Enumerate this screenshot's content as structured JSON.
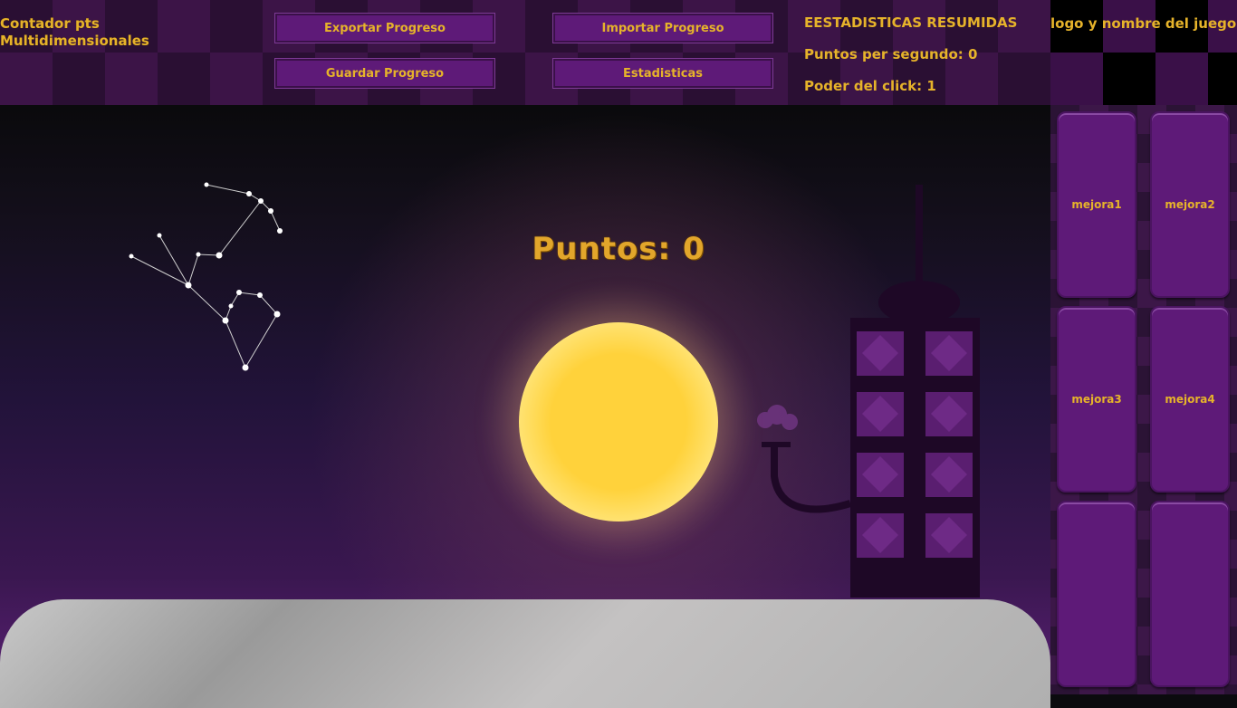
{
  "header": {
    "title": "Contador pts Multidimensionales",
    "export_label": "Exportar Progreso",
    "import_label": "Importar Progreso",
    "save_label": "Guardar Progreso",
    "stats_label": "Estadisticas"
  },
  "summary": {
    "heading": "EESTADISTICAS RESUMIDAS",
    "pps": "Puntos per segundo: 0",
    "click_power": "Poder del click: 1"
  },
  "logo": {
    "text": "logo y nombre del juego"
  },
  "game": {
    "points": "Puntos: 0"
  },
  "upgrades": [
    "mejora1",
    "mejora2",
    "mejora3",
    "mejora4",
    "",
    ""
  ]
}
